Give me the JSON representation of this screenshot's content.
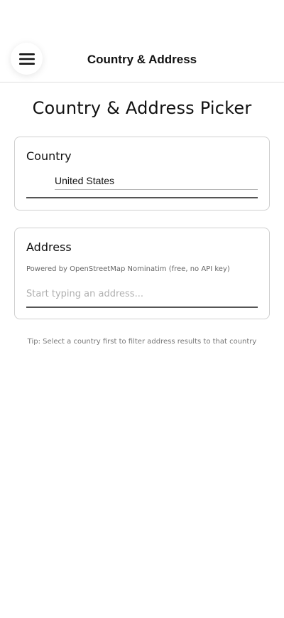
{
  "header": {
    "title": "Country & Address",
    "menu_icon": "hamburger-menu-icon"
  },
  "page": {
    "title": "Country & Address Picker"
  },
  "country_card": {
    "label": "Country",
    "selected_value": "United States"
  },
  "address_card": {
    "label": "Address",
    "powered_by": "Powered by OpenStreetMap Nominatim (free, no API key)",
    "placeholder": "Start typing an address...",
    "value": ""
  },
  "tip": "Tip: Select a country first to filter address results to that country",
  "colors": {
    "text": "#111111",
    "muted": "#666666",
    "border": "#cfcfcf",
    "underline": "#555555"
  }
}
